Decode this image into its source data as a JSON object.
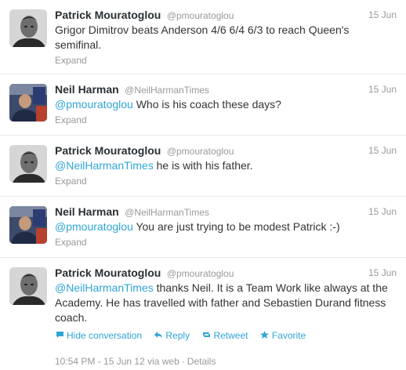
{
  "tweets": [
    {
      "fullname": "Patrick Mouratoglou",
      "username": "@pmouratoglou",
      "time": "15 Jun",
      "mention": "",
      "text": "Grigor Dimitrov beats Anderson 4/6 6/4 6/3 to reach Queen's semifinal.",
      "footer": "Expand"
    },
    {
      "fullname": "Neil Harman",
      "username": "@NeilHarmanTimes",
      "time": "15 Jun",
      "mention": "@pmouratoglou",
      "text": " Who is his coach these days?",
      "footer": "Expand"
    },
    {
      "fullname": "Patrick Mouratoglou",
      "username": "@pmouratoglou",
      "time": "15 Jun",
      "mention": "@NeilHarmanTimes",
      "text": " he is with his father.",
      "footer": "Expand"
    },
    {
      "fullname": "Neil Harman",
      "username": "@NeilHarmanTimes",
      "time": "15 Jun",
      "mention": "@pmouratoglou",
      "text": " You are just trying to be modest Patrick :-)",
      "footer": "Expand"
    },
    {
      "fullname": "Patrick Mouratoglou",
      "username": "@pmouratoglou",
      "time": "15 Jun",
      "mention": "@NeilHarmanTimes",
      "text": " thanks Neil. It is a Team Work like always at the Academy. He has travelled with father and Sebastien Durand fitness coach.",
      "actions": {
        "hide": "Hide conversation",
        "reply": "Reply",
        "retweet": "Retweet",
        "favorite": "Favorite"
      },
      "meta": {
        "timestamp": "10:54 PM - 15 Jun 12",
        "via": "via web",
        "separator": "·",
        "details": "Details"
      }
    }
  ],
  "colors": {
    "link": "#2fa5d6",
    "muted": "#999999",
    "name": "#292f33"
  },
  "icons": {
    "hide": "speech-bubble-icon",
    "reply": "reply-arrow-icon",
    "retweet": "retweet-icon",
    "favorite": "star-icon"
  }
}
